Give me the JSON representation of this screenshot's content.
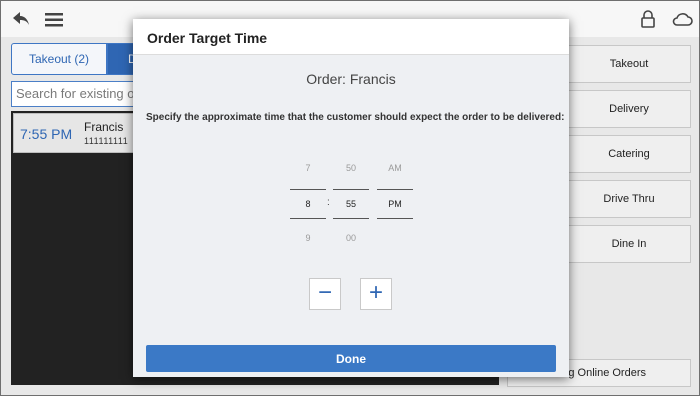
{
  "app": {
    "tabs": [
      {
        "label": "Takeout (2)"
      },
      {
        "label": "D"
      }
    ],
    "search_placeholder": "Search for existing orders",
    "orders": [
      {
        "time": "7:55 PM",
        "name": "Francis",
        "phone": "111111111"
      }
    ],
    "order_types": [
      "Takeout",
      "Delivery",
      "Catering",
      "Drive Thru",
      "Dine In"
    ],
    "online_orders_label": "ing Online Orders"
  },
  "icons": {
    "back": "back-arrow-icon",
    "menu": "hamburger-menu-icon",
    "lock": "lock-icon",
    "cloud": "cloud-icon"
  },
  "modal": {
    "title": "Order Target Time",
    "order_label": "Order: Francis",
    "instructions": "Specify the approximate time that the customer should expect the order to be delivered:",
    "hour": {
      "above": "7",
      "selected": "8",
      "below": "9"
    },
    "separator": ":",
    "minute": {
      "above": "50",
      "selected": "55",
      "below": "00"
    },
    "ampm": {
      "above": "AM",
      "selected": "PM",
      "below": ""
    },
    "minus_label": "−",
    "plus_label": "+",
    "done_label": "Done"
  },
  "colors": {
    "accent": "#3b79c6",
    "tab_active": "#2f66b3",
    "panel_dark": "#222222"
  }
}
